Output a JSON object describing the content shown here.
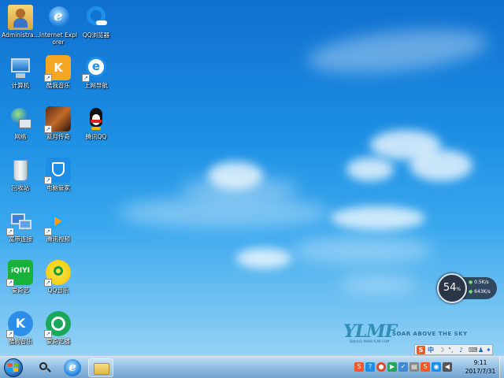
{
  "desktop": {
    "icons": [
      {
        "label": "Administra...",
        "icon": "user-folder-icon"
      },
      {
        "label": "Internet Explorer",
        "icon": "ie-icon"
      },
      {
        "label": "QQ浏览器",
        "icon": "qq-browser-icon"
      },
      {
        "label": "计算机",
        "icon": "computer-icon"
      },
      {
        "label": "酷我音乐",
        "icon": "kuwo-music-icon"
      },
      {
        "label": "上网导航",
        "icon": "web-nav-icon"
      },
      {
        "label": "网络",
        "icon": "network-icon"
      },
      {
        "label": "蓝月传奇",
        "icon": "game-icon"
      },
      {
        "label": "腾讯QQ",
        "icon": "qq-penguin-icon"
      },
      {
        "label": "回收站",
        "icon": "recycle-bin-icon"
      },
      {
        "label": "电脑管家",
        "icon": "pc-manager-icon"
      },
      {
        "label": "宽带连接",
        "icon": "broadband-icon"
      },
      {
        "label": "腾讯视频",
        "icon": "tencent-video-icon"
      },
      {
        "label": "爱奇艺",
        "icon": "iqiyi-icon"
      },
      {
        "label": "QQ音乐",
        "icon": "qq-music-icon"
      },
      {
        "label": "酷狗音乐",
        "icon": "kugou-icon"
      },
      {
        "label": "爱奇艺播",
        "icon": "media-player-icon"
      }
    ]
  },
  "brand": {
    "mark": "YLMF",
    "slogan": "SOAR ABOVE THE SKY",
    "small": "雨林木风 WWW.YLMF.COM"
  },
  "net_widget": {
    "percent": "54",
    "percent_unit": "%",
    "up": "0.5",
    "up_unit": "K/s",
    "down": "643",
    "down_unit": "K/s"
  },
  "ime": {
    "logo": "S",
    "lang": "中"
  },
  "taskbar": {
    "time": "9:11",
    "date": "2017/7/31"
  },
  "colors": {
    "accent": "#1c8ee3",
    "taskbar": "#8fb8dd"
  }
}
